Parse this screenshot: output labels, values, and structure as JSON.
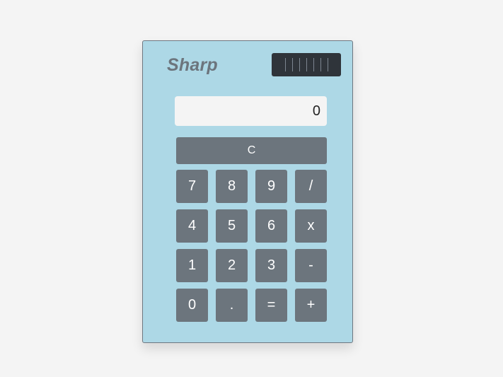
{
  "brand": "Sharp",
  "display": {
    "value": "0"
  },
  "keys": {
    "clear": "C",
    "seven": "7",
    "eight": "8",
    "nine": "9",
    "divide": "/",
    "four": "4",
    "five": "5",
    "six": "6",
    "multiply": "x",
    "one": "1",
    "two": "2",
    "three": "3",
    "subtract": "-",
    "zero": "0",
    "decimal": ".",
    "equals": "=",
    "add": "+"
  },
  "colors": {
    "body": "#add8e6",
    "key": "#6c757d",
    "key_text": "#ffffff",
    "display_bg": "#f4f4f4",
    "solar_panel": "#2f343a"
  },
  "icons": {
    "solar_panel": "solar-panel-icon"
  }
}
